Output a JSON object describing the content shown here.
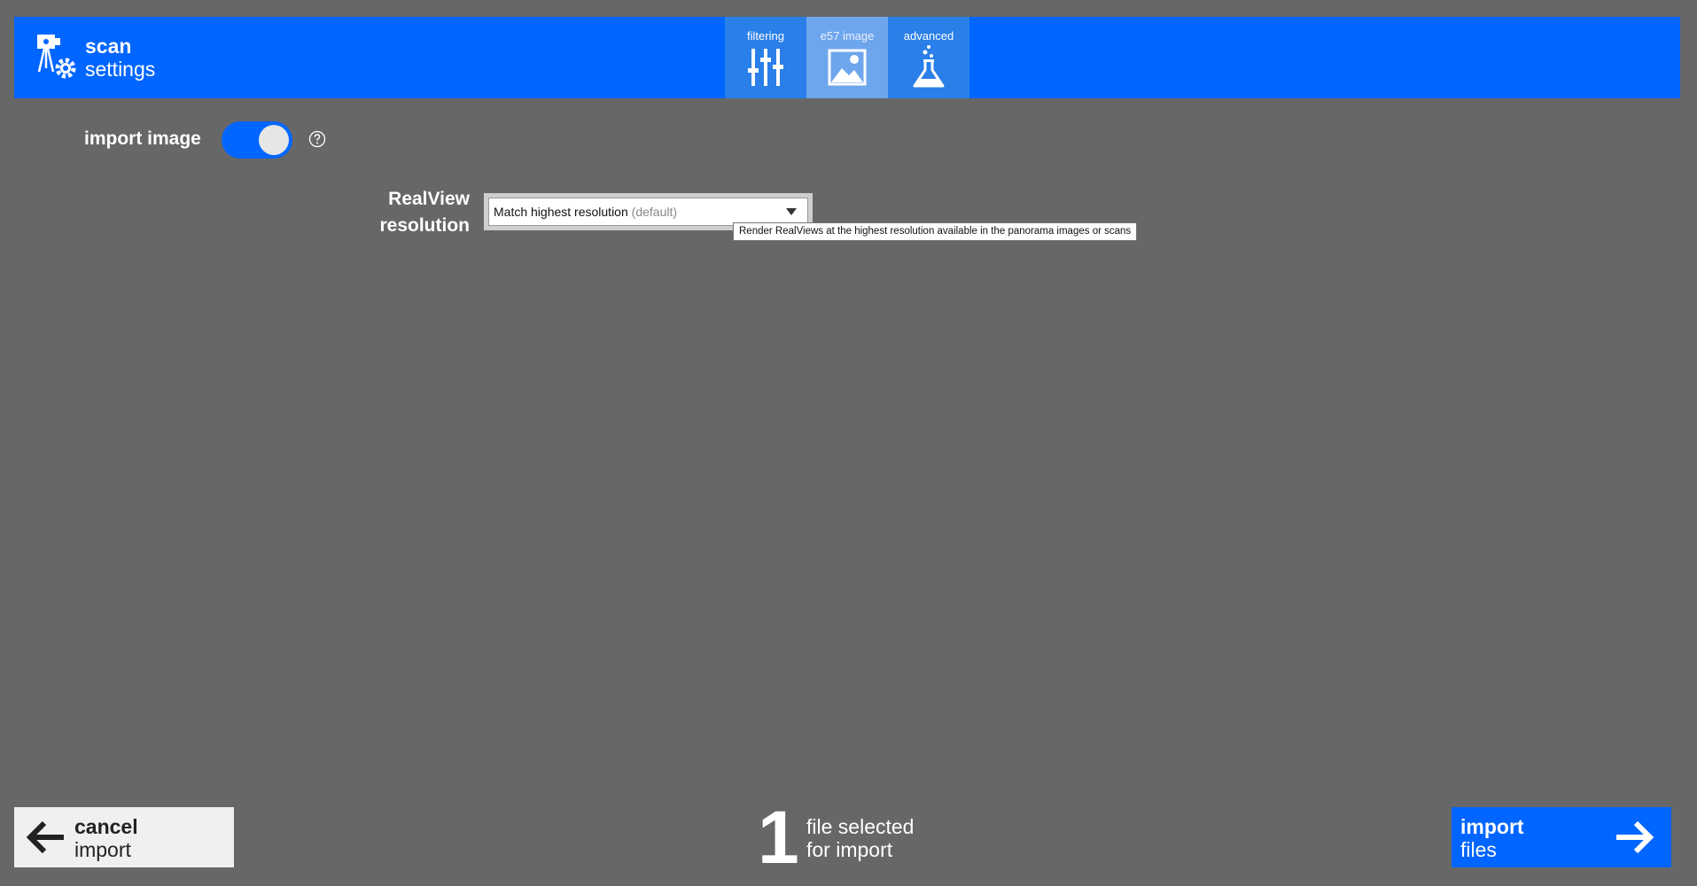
{
  "header": {
    "title_bold": "scan",
    "title_light": "settings",
    "logo_icon": "scanner-gear-icon",
    "accent_color": "#0066ff",
    "tabs": [
      {
        "label": "filtering",
        "icon": "sliders-icon",
        "active": false
      },
      {
        "label": "e57 image",
        "icon": "image-icon",
        "active": true
      },
      {
        "label": "advanced",
        "icon": "flask-icon",
        "active": false
      }
    ]
  },
  "content": {
    "import_image": {
      "label": "import image",
      "enabled": true,
      "help_icon": "help-icon"
    },
    "realview": {
      "label_line1": "RealView",
      "label_line2": "resolution",
      "selected_value": "Match highest resolution",
      "selected_suffix": "(default)",
      "tooltip": "Render RealViews at the highest resolution available in the panorama images or scans"
    }
  },
  "footer": {
    "cancel": {
      "bold": "cancel",
      "light": "import",
      "icon": "arrow-left-icon"
    },
    "selection": {
      "count": "1",
      "line1": "file selected",
      "line2": "for import"
    },
    "import": {
      "bold": "import",
      "light": "files",
      "icon": "arrow-right-icon"
    }
  }
}
